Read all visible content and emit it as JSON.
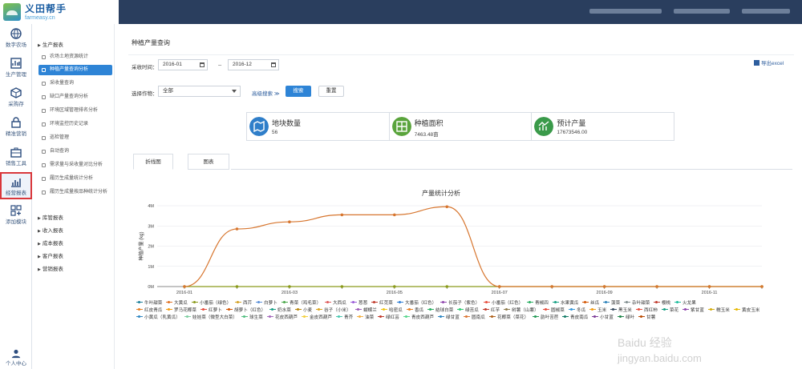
{
  "brand": {
    "title": "义田帮手",
    "subtitle": "farmeasy.cn"
  },
  "rail": [
    {
      "name": "digital-farm",
      "label": "数字农场"
    },
    {
      "name": "production",
      "label": "生产管理"
    },
    {
      "name": "purchase",
      "label": "采购存"
    },
    {
      "name": "trace",
      "label": "精准营销"
    },
    {
      "name": "sales",
      "label": "销售工具"
    },
    {
      "name": "reports",
      "label": "经营报表"
    },
    {
      "name": "add-module",
      "label": "添加模块"
    }
  ],
  "user_center": "个人中心",
  "menu": {
    "production_report": "生产报表",
    "items": [
      "农场土地资源统计",
      "种植产量查询分析",
      "采收量查询",
      "缺口产量查询分析",
      "环境区域管理排名分析",
      "环境监控历史记录",
      "巡检管理",
      "自动查询",
      "需求量与采收量对比分析",
      "履历生成量统计分析",
      "履历生成量按品种统计分析"
    ],
    "groups": [
      "库管报表",
      "收入报表",
      "成本报表",
      "客户报表",
      "营销报表"
    ]
  },
  "page": {
    "title": "种植产量查询"
  },
  "filters": {
    "date_label": "采收时间：",
    "date_from": "2016-01",
    "date_sep": "--",
    "date_to": "2016-12",
    "crop_label": "选择作物：",
    "crop_value": "全部",
    "advanced": "高级搜索",
    "search": "搜索",
    "reset": "重置",
    "export": "导出excel"
  },
  "stats": [
    {
      "title": "地块数量",
      "value": "56",
      "color": "#2f7ec9",
      "icon": "map-icon"
    },
    {
      "title": "种植面积",
      "value": "7463.48亩",
      "color": "#5aa43c",
      "icon": "grid-icon"
    },
    {
      "title": "预计产量",
      "value": "17673546.00",
      "color": "#3a9a4a",
      "icon": "trend-icon"
    }
  ],
  "tabs": [
    "折线图",
    "图表"
  ],
  "chart_data": {
    "type": "line",
    "title": "产量统计分析",
    "ylabel": "种植产量 (kg)",
    "x": [
      "2016-01",
      "2016-02",
      "2016-03",
      "2016-04",
      "2016-05",
      "2016-06",
      "2016-07",
      "2016-08",
      "2016-09",
      "2016-10",
      "2016-11",
      "2016-12"
    ],
    "xticks": [
      "2016-01",
      "2016-03",
      "2016-05",
      "2016-07",
      "2016-09",
      "2016-11"
    ],
    "yticks": [
      "0M",
      "1M",
      "2M",
      "3M",
      "4M"
    ],
    "ylim": [
      0,
      4000000
    ],
    "series": [
      {
        "name": "大白菜",
        "color": "#d7762f",
        "values": [
          0,
          2850000,
          3200000,
          3550000,
          3550000,
          3950000,
          0,
          0,
          0,
          0,
          0,
          0
        ]
      },
      {
        "name": "小番茄（绿色）",
        "color": "#8a9a1a",
        "values": [
          0,
          0,
          0,
          0,
          0,
          0,
          0,
          0,
          0,
          0,
          0,
          0
        ]
      }
    ]
  },
  "legend": [
    [
      "牛叶甜菜",
      "#1a7f9a"
    ],
    [
      "大黄瓜",
      "#e07020"
    ],
    [
      "小番茄（绿色）",
      "#8a9a1a"
    ],
    [
      "西芹",
      "#d4a020"
    ],
    [
      "白萝卜",
      "#5a8fd8"
    ],
    [
      "青菜（鸡毛菜）",
      "#4aa84a"
    ],
    [
      "大西瓜",
      "#e05a5a"
    ],
    [
      "葱葱",
      "#9a5ad8"
    ],
    [
      "红苋菜",
      "#c0392b"
    ],
    [
      "大番茄（红色）",
      "#2e7ed6"
    ],
    [
      "长茄子（紫色）",
      "#8e44ad"
    ],
    [
      "小番茄（红色）",
      "#e74c3c"
    ],
    [
      "青椒四",
      "#27ae60"
    ],
    [
      "水果黄瓜",
      "#16a085"
    ],
    [
      "丝瓜",
      "#d35400"
    ],
    [
      "菠菜",
      "#2980b9"
    ],
    [
      "杂叶甜菜",
      "#7f8c8d"
    ],
    [
      "樱桃",
      "#c0392b"
    ],
    [
      "火龙果",
      "#1abc9c"
    ],
    [
      "红皮青瓜",
      "#e67e22"
    ],
    [
      "罗马花椰菜",
      "#f39c12"
    ],
    [
      "红萝卜",
      "#e74c3c"
    ],
    [
      "胡萝卜（红色）",
      "#d35400"
    ],
    [
      "奶水菜",
      "#16a085"
    ],
    [
      "小麦",
      "#b8860b"
    ],
    [
      "谷子（小米）",
      "#daa520"
    ],
    [
      "蝴蝶兰",
      "#9b59b6"
    ],
    [
      "哈密瓜",
      "#f1c40f"
    ],
    [
      "香瓜",
      "#e67e22"
    ],
    [
      "结球白菜",
      "#27ae60"
    ],
    [
      "绿苦瓜",
      "#2ecc71"
    ],
    [
      "红芋",
      "#c0392b"
    ],
    [
      "树薯（山薯）",
      "#8e7a4a"
    ],
    [
      "圆椒菜",
      "#e74c3c"
    ],
    [
      "冬瓜",
      "#3498db"
    ],
    [
      "玉米",
      "#f39c12"
    ],
    [
      "黑玉米",
      "#34495e"
    ],
    [
      "西红柿",
      "#e74c3c"
    ],
    [
      "菜花",
      "#16a085"
    ],
    [
      "紫甘蓝",
      "#8e44ad"
    ],
    [
      "糯玉米",
      "#d4ac0d"
    ],
    [
      "黄皮玉米",
      "#e6b800"
    ],
    [
      "小黄瓜（乳黄瓜）",
      "#2e86c1"
    ],
    [
      "娃娃菜（微型大白菜）",
      "#7dcea0"
    ],
    [
      "球生菜",
      "#52be80"
    ],
    [
      "花皮西葫芦",
      "#a569bd"
    ],
    [
      "金皮西葫芦",
      "#f4d03f"
    ],
    [
      "青芥",
      "#48c9b0"
    ],
    [
      "油菜",
      "#f5b041"
    ],
    [
      "绿红芸",
      "#c0392b"
    ],
    [
      "青皮西葫芦",
      "#58d68d"
    ],
    [
      "绿甘蓝",
      "#2e86c1"
    ],
    [
      "圆南瓜",
      "#dc7633"
    ],
    [
      "花椰菜（菜花）",
      "#af601a"
    ],
    [
      "韵叶苦苣",
      "#229954"
    ],
    [
      "青皮南瓜",
      "#117a65"
    ],
    [
      "小甘蓝",
      "#7d3c98"
    ],
    [
      "绿叶",
      "#1e8449"
    ],
    [
      "甘薯",
      "#ba4a00"
    ]
  ]
}
